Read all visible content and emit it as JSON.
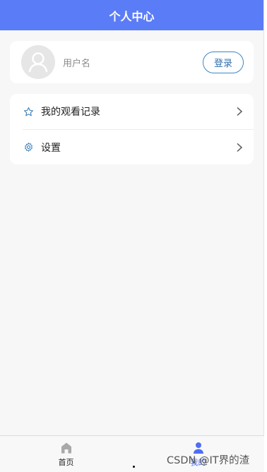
{
  "header": {
    "title": "个人中心"
  },
  "profile": {
    "username": "用户名",
    "login_label": "登录"
  },
  "menu": {
    "items": [
      {
        "label": "我的观看记录",
        "icon": "star-icon"
      },
      {
        "label": "设置",
        "icon": "gear-icon"
      }
    ]
  },
  "tabbar": {
    "items": [
      {
        "label": "首页",
        "icon": "home-icon",
        "active": false
      },
      {
        "label": "我的",
        "icon": "person-icon",
        "active": true
      }
    ]
  },
  "watermark": "CSDN @IT界的渣",
  "colors": {
    "header": "#5b7cf7",
    "accent_blue": "#3d86c6",
    "tab_active": "#4f6df5"
  }
}
